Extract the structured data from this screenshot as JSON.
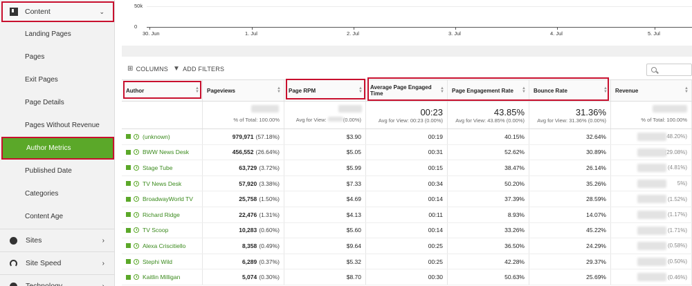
{
  "sidebar": {
    "section": {
      "label": "Content",
      "chevron": "⌄"
    },
    "items": [
      {
        "label": "Landing Pages"
      },
      {
        "label": "Pages"
      },
      {
        "label": "Exit Pages"
      },
      {
        "label": "Page Details"
      },
      {
        "label": "Pages Without Revenue"
      },
      {
        "label": "Author Metrics",
        "active": true
      },
      {
        "label": "Published Date"
      },
      {
        "label": "Categories"
      },
      {
        "label": "Content Age"
      }
    ],
    "sections": [
      {
        "label": "Sites",
        "icon": "globe-icon"
      },
      {
        "label": "Site Speed",
        "icon": "gauge-icon"
      },
      {
        "label": "Technology",
        "icon": "device-icon"
      }
    ]
  },
  "chart": {
    "y_ticks": [
      "50k",
      "0"
    ],
    "x_ticks": [
      "30. Jun",
      "1. Jul",
      "2. Jul",
      "3. Jul",
      "4. Jul",
      "5. Jul"
    ]
  },
  "toolbar": {
    "columns_label": "COLUMNS",
    "filters_label": "ADD FILTERS"
  },
  "table": {
    "headers": [
      "Author",
      "Pageviews",
      "Page RPM",
      "Average Page Engaged Time",
      "Page Engagement Rate",
      "Bounce Rate",
      "Revenue"
    ],
    "totals": {
      "pageviews_small": "% of Total: 100.00%",
      "rpm_small": "Avg for View:",
      "rpm_small_pct": "(0.00%)",
      "engaged_big": "00:23",
      "engaged_small": "Avg for View: 00:23 (0.00%)",
      "engrate_big": "43.85%",
      "engrate_small": "Avg for View: 43.85% (0.00%)",
      "bounce_big": "31.36%",
      "bounce_small": "Avg for View: 31.36% (0.00%)",
      "revenue_small": "% of Total: 100.00%"
    },
    "rows": [
      {
        "author": "(unknown)",
        "pv": "979,971",
        "pv_pct": "(57.18%)",
        "rpm": "$3.90",
        "time": "00:19",
        "eng": "40.15%",
        "bounce": "32.64%",
        "rev_pct": "48.20%)"
      },
      {
        "author": "BWW News Desk",
        "pv": "456,552",
        "pv_pct": "(26.64%)",
        "rpm": "$5.05",
        "time": "00:31",
        "eng": "52.62%",
        "bounce": "30.89%",
        "rev_pct": "(29.08%)"
      },
      {
        "author": "Stage Tube",
        "pv": "63,729",
        "pv_pct": "(3.72%)",
        "rpm": "$5.99",
        "time": "00:15",
        "eng": "38.47%",
        "bounce": "26.14%",
        "rev_pct": "(4.81%)"
      },
      {
        "author": "TV News Desk",
        "pv": "57,920",
        "pv_pct": "(3.38%)",
        "rpm": "$7.33",
        "time": "00:34",
        "eng": "50.20%",
        "bounce": "35.26%",
        "rev_pct": "5%)"
      },
      {
        "author": "BroadwayWorld TV",
        "pv": "25,758",
        "pv_pct": "(1.50%)",
        "rpm": "$4.69",
        "time": "00:14",
        "eng": "37.39%",
        "bounce": "28.59%",
        "rev_pct": "(1.52%)"
      },
      {
        "author": "Richard Ridge",
        "pv": "22,476",
        "pv_pct": "(1.31%)",
        "rpm": "$4.13",
        "time": "00:11",
        "eng": "8.93%",
        "bounce": "14.07%",
        "rev_pct": "(1.17%)"
      },
      {
        "author": "TV Scoop",
        "pv": "10,283",
        "pv_pct": "(0.60%)",
        "rpm": "$5.60",
        "time": "00:14",
        "eng": "33.26%",
        "bounce": "45.22%",
        "rev_pct": "(1.71%)"
      },
      {
        "author": "Alexa Criscitiello",
        "pv": "8,358",
        "pv_pct": "(0.49%)",
        "rpm": "$9.64",
        "time": "00:25",
        "eng": "36.50%",
        "bounce": "24.29%",
        "rev_pct": "(0.58%)"
      },
      {
        "author": "Stephi Wild",
        "pv": "6,289",
        "pv_pct": "(0.37%)",
        "rpm": "$5.32",
        "time": "00:25",
        "eng": "42.28%",
        "bounce": "29.37%",
        "rev_pct": "(0.50%)"
      },
      {
        "author": "Kaitlin Milligan",
        "pv": "5,074",
        "pv_pct": "(0.30%)",
        "rpm": "$8.70",
        "time": "00:30",
        "eng": "50.63%",
        "bounce": "25.69%",
        "rev_pct": "(0.46%)"
      }
    ]
  }
}
